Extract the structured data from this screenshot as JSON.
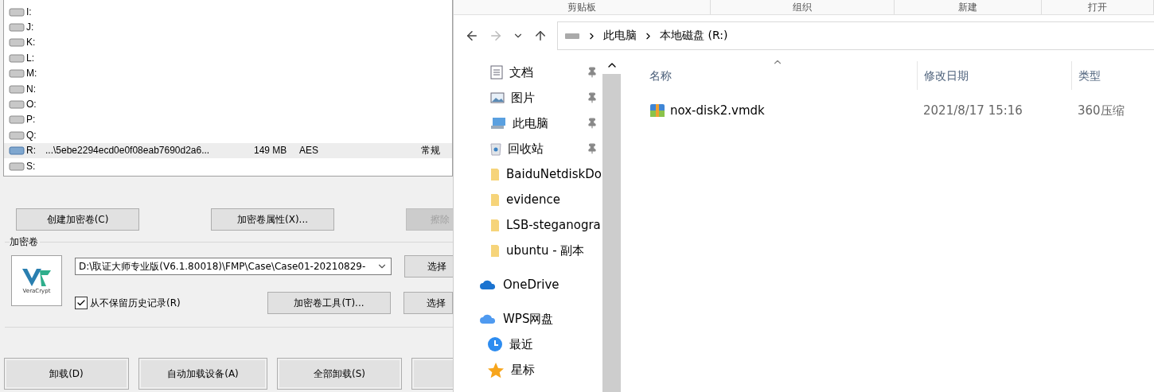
{
  "veracrypt": {
    "drives": [
      {
        "drive": "I:",
        "selected": false
      },
      {
        "drive": "J:",
        "selected": false
      },
      {
        "drive": "K:",
        "selected": false
      },
      {
        "drive": "L:",
        "selected": false
      },
      {
        "drive": "M:",
        "selected": false
      },
      {
        "drive": "N:",
        "selected": false
      },
      {
        "drive": "O:",
        "selected": false
      },
      {
        "drive": "P:",
        "selected": false
      },
      {
        "drive": "Q:",
        "selected": false
      },
      {
        "drive": "R:",
        "mounted": true,
        "path": "...\\5ebe2294ecd0e0f08eab7690d2a6...",
        "size": "149 MB",
        "algorithm": "AES",
        "type": "常规",
        "selected": true
      },
      {
        "drive": "S:",
        "selected": false
      }
    ],
    "top_buttons": [
      {
        "label": "创建加密卷(C)",
        "disabled": false
      },
      {
        "label": "加密卷属性(X)...",
        "disabled": false
      },
      {
        "label": "擦除",
        "disabled": true
      }
    ],
    "volume_group": {
      "title": "加密卷",
      "logo_text": "VeraCrypt",
      "path_value": "D:\\取证大师专业版(V6.1.80018)\\FMP\\Case\\Case01-20210829-",
      "never_save_history": {
        "label": "从不保留历史记录(R)",
        "checked": true
      },
      "tools_button": "加密卷工具(T)...",
      "select_buttons": [
        "选择",
        "选择"
      ]
    },
    "bottom_buttons": [
      "卸载(D)",
      "自动加载设备(A)",
      "全部卸载(S)"
    ]
  },
  "explorer": {
    "ribbon_groups": [
      "剪贴板",
      "组织",
      "新建",
      "打开"
    ],
    "breadcrumb": [
      "此电脑",
      "本地磁盘 (R:)"
    ],
    "nav_items": [
      {
        "kind": "docs",
        "label": "文档",
        "pinned": true
      },
      {
        "kind": "pictures",
        "label": "图片",
        "pinned": true
      },
      {
        "kind": "pc",
        "label": "此电脑",
        "pinned": true
      },
      {
        "kind": "recycle",
        "label": "回收站",
        "pinned": true
      },
      {
        "kind": "folder",
        "label": "BaiduNetdiskDo",
        "pinned": false
      },
      {
        "kind": "folder",
        "label": "evidence",
        "pinned": false
      },
      {
        "kind": "folder",
        "label": "LSB-steganogra",
        "pinned": false
      },
      {
        "kind": "folder",
        "label": "ubuntu - 副本",
        "pinned": false
      },
      {
        "kind": "onedrive",
        "label": "OneDrive",
        "pinned": false
      },
      {
        "kind": "cloud",
        "label": "WPS网盘",
        "pinned": false
      },
      {
        "kind": "recent",
        "label": "最近",
        "pinned": false
      },
      {
        "kind": "star",
        "label": "星标",
        "pinned": false
      }
    ],
    "columns": [
      "名称",
      "修改日期",
      "类型"
    ],
    "files": [
      {
        "name": "nox-disk2.vmdk",
        "modified": "2021/8/17 15:16",
        "type": "360压缩"
      }
    ]
  }
}
